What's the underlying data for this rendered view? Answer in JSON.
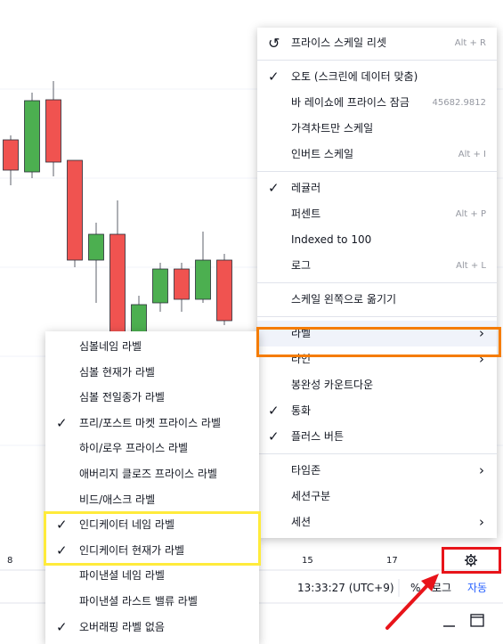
{
  "chart": {
    "candles": [
      {
        "o": 191,
        "h": 208,
        "l": 152,
        "c": 157,
        "up": false
      },
      {
        "o": 193,
        "h": 200,
        "l": 104,
        "c": 113,
        "up": true
      },
      {
        "o": 112,
        "h": 198,
        "l": 91,
        "c": 182,
        "up": false
      },
      {
        "o": 180,
        "h": 300,
        "l": 180,
        "c": 292,
        "up": false
      },
      {
        "o": 292,
        "h": 340,
        "l": 250,
        "c": 263,
        "up": true
      },
      {
        "o": 263,
        "h": 380,
        "l": 225,
        "c": 375,
        "up": false
      },
      {
        "o": 373,
        "h": 373,
        "l": 332,
        "c": 342,
        "up": true
      },
      {
        "o": 340,
        "h": 350,
        "l": 295,
        "c": 302,
        "up": true
      },
      {
        "o": 302,
        "h": 350,
        "l": 295,
        "c": 336,
        "up": false
      },
      {
        "o": 336,
        "h": 340,
        "l": 260,
        "c": 292,
        "up": true
      },
      {
        "o": 292,
        "h": 365,
        "l": 285,
        "c": 360,
        "up": false
      }
    ],
    "colors": {
      "up": "#4caf50",
      "down": "#f05350"
    },
    "time_labels": [
      {
        "text": "8"
      },
      {
        "text": "15"
      },
      {
        "text": "17"
      }
    ],
    "time_readout": "13:33:27 (UTC+9)",
    "percent_label": "%",
    "log_label": "로그",
    "auto_label": "자동",
    "settings_icon": "gear-icon"
  },
  "scale_menu": {
    "items": [
      {
        "type": "item",
        "icon": "reset-icon",
        "label": "프라이스 스케일 리셋",
        "shortcut": "Alt + R"
      },
      {
        "type": "sep"
      },
      {
        "type": "item",
        "checked": true,
        "label": "오토 (스크린에 데이터 맞춤)"
      },
      {
        "type": "item",
        "label": "바 레이쇼에 프라이스 잠금",
        "shortcut": "45682.9812"
      },
      {
        "type": "item",
        "label": "가격차트만 스케일"
      },
      {
        "type": "item",
        "label": "인버트 스케일",
        "shortcut": "Alt + I"
      },
      {
        "type": "sep"
      },
      {
        "type": "item",
        "checked": true,
        "label": "레귤러"
      },
      {
        "type": "item",
        "label": "퍼센트",
        "shortcut": "Alt + P"
      },
      {
        "type": "item",
        "label": "Indexed to 100"
      },
      {
        "type": "item",
        "label": "로그",
        "shortcut": "Alt + L"
      },
      {
        "type": "sep"
      },
      {
        "type": "item",
        "label": "스케일 왼쪽으로 옮기기"
      },
      {
        "type": "sep"
      },
      {
        "type": "item",
        "label": "라벨",
        "arrow": true,
        "active": true
      },
      {
        "type": "item",
        "label": "라인",
        "arrow": true
      },
      {
        "type": "item",
        "label": "봉완성 카운트다운"
      },
      {
        "type": "item",
        "checked": true,
        "label": "통화"
      },
      {
        "type": "item",
        "checked": true,
        "label": "플러스 버튼"
      },
      {
        "type": "sep"
      },
      {
        "type": "item",
        "label": "타임존",
        "arrow": true
      },
      {
        "type": "item",
        "label": "세션구분"
      },
      {
        "type": "item",
        "label": "세션",
        "arrow": true
      }
    ]
  },
  "labels_menu": {
    "items": [
      {
        "label": "심볼네임 라벨",
        "checked": false
      },
      {
        "label": "심볼 현재가 라벨",
        "checked": false
      },
      {
        "label": "심볼 전일종가 라벨",
        "checked": false
      },
      {
        "label": "프리/포스트 마켓 프라이스 라벨",
        "checked": true
      },
      {
        "label": "하이/로우 프라이스 라벨",
        "checked": false
      },
      {
        "label": "애버리지 클로즈 프라이스 라벨",
        "checked": false
      },
      {
        "label": "비드/애스크 라벨",
        "checked": false
      },
      {
        "label": "인디케이터 네임 라벨",
        "checked": true
      },
      {
        "label": "인디케이터 현재가 라벨",
        "checked": true
      },
      {
        "label": "파이낸셜 네임 라벨",
        "checked": false
      },
      {
        "label": "파이낸셜 라스트 밸류 라벨",
        "checked": false
      },
      {
        "label": "오버래핑 라벨 없음",
        "checked": true
      }
    ]
  },
  "annotations": {
    "orange_color": "#f57c00",
    "yellow_color": "#ffeb3b",
    "red_color": "#e8141a"
  }
}
